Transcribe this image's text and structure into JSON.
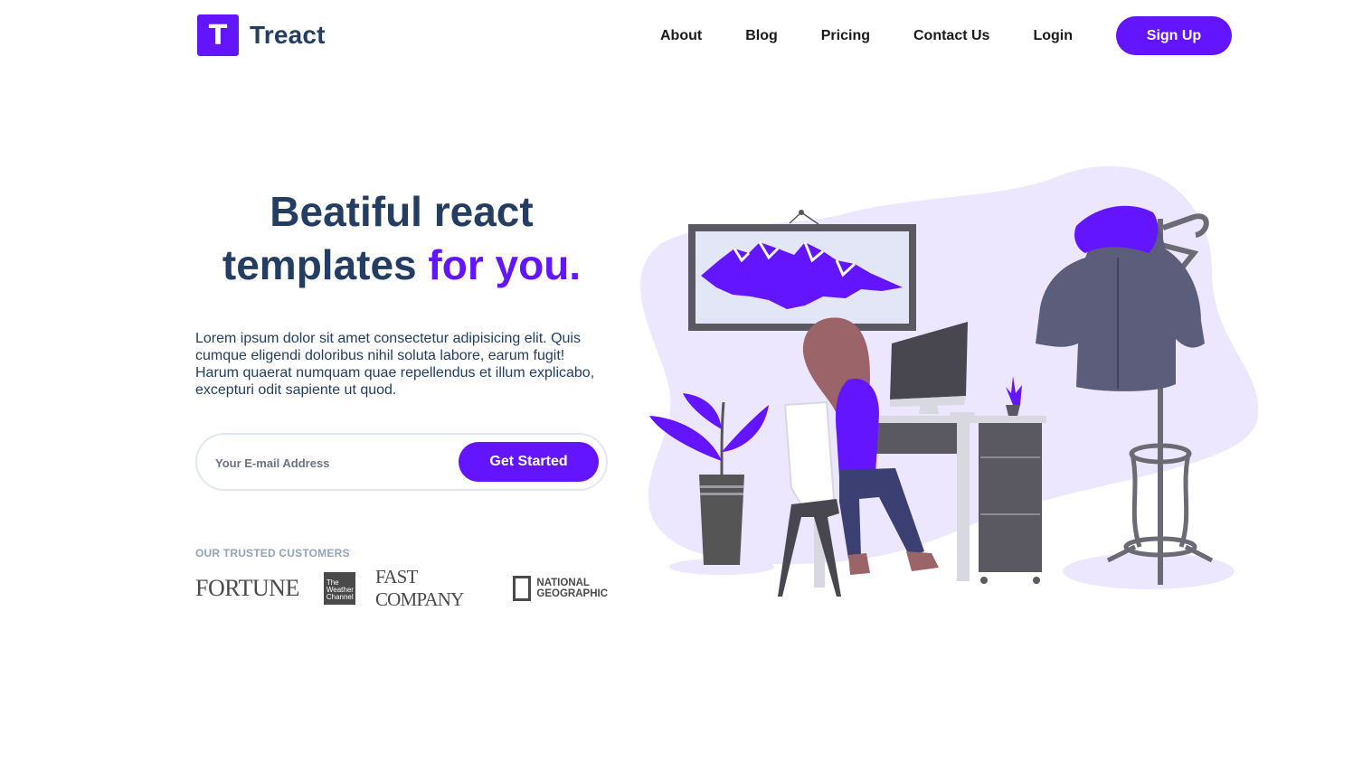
{
  "brand": {
    "logo_letter": "T",
    "name": "Treact"
  },
  "nav": {
    "links": [
      "About",
      "Blog",
      "Pricing",
      "Contact Us",
      "Login"
    ],
    "signup_label": "Sign Up"
  },
  "hero": {
    "headline_part1": "Beatiful react",
    "headline_part2": "templates",
    "headline_accent": "for you.",
    "description": "Lorem ipsum dolor sit amet consectetur adipisicing elit. Quis cumque eligendi doloribus nihil soluta labore, earum fugit! Harum quaerat numquam quae repellendus et illum explicabo, excepturi odit sapiente ut quod.",
    "email_placeholder": "Your E-mail Address",
    "cta_label": "Get Started",
    "trusted_label": "Our Trusted Customers"
  },
  "customers": {
    "fortune": "FORTUNE",
    "weather_line1": "The",
    "weather_line2": "Weather",
    "weather_line3": "Channel",
    "fastcompany": "FAST COMPANY",
    "natgeo_line1": "NATIONAL",
    "natgeo_line2": "GEOGRAPHIC"
  },
  "colors": {
    "primary": "#6415ff",
    "heading": "#243e63",
    "muted": "#94a3b8",
    "blob": "#ede6ff"
  }
}
